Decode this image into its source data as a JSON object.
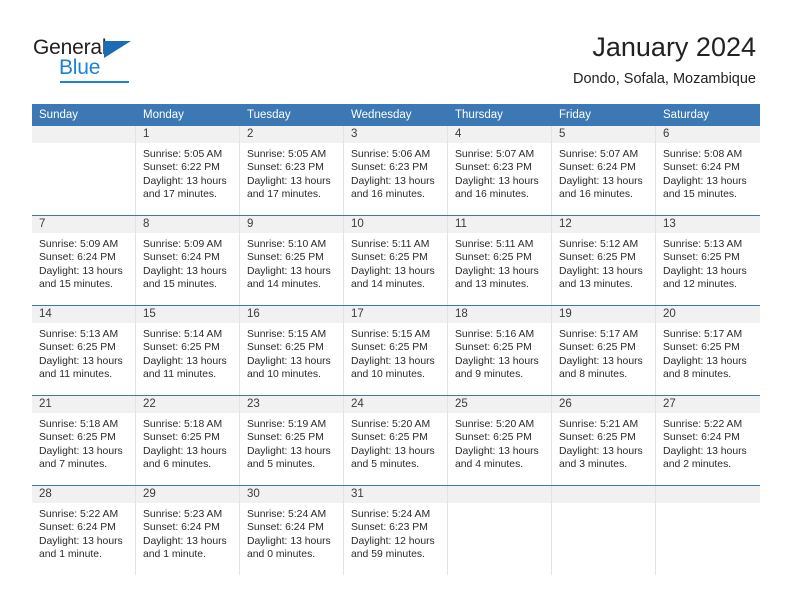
{
  "brand": {
    "name_top": "General",
    "name_bottom": "Blue",
    "logo_icon": "triangle-icon",
    "accent_color": "#1c83d4",
    "triangle_color": "#1c6cb5"
  },
  "header": {
    "title": "January 2024",
    "subtitle": "Dondo, Sofala, Mozambique"
  },
  "calendar": {
    "header_bg": "#3c78b4",
    "daynum_bg": "#f1f1f1",
    "weekday_headers": [
      "Sunday",
      "Monday",
      "Tuesday",
      "Wednesday",
      "Thursday",
      "Friday",
      "Saturday"
    ],
    "weeks": [
      [
        {
          "day": "",
          "sunrise": "",
          "sunset": "",
          "daylight_line1": "",
          "daylight_line2": ""
        },
        {
          "day": "1",
          "sunrise": "Sunrise: 5:05 AM",
          "sunset": "Sunset: 6:22 PM",
          "daylight_line1": "Daylight: 13 hours",
          "daylight_line2": "and 17 minutes."
        },
        {
          "day": "2",
          "sunrise": "Sunrise: 5:05 AM",
          "sunset": "Sunset: 6:23 PM",
          "daylight_line1": "Daylight: 13 hours",
          "daylight_line2": "and 17 minutes."
        },
        {
          "day": "3",
          "sunrise": "Sunrise: 5:06 AM",
          "sunset": "Sunset: 6:23 PM",
          "daylight_line1": "Daylight: 13 hours",
          "daylight_line2": "and 16 minutes."
        },
        {
          "day": "4",
          "sunrise": "Sunrise: 5:07 AM",
          "sunset": "Sunset: 6:23 PM",
          "daylight_line1": "Daylight: 13 hours",
          "daylight_line2": "and 16 minutes."
        },
        {
          "day": "5",
          "sunrise": "Sunrise: 5:07 AM",
          "sunset": "Sunset: 6:24 PM",
          "daylight_line1": "Daylight: 13 hours",
          "daylight_line2": "and 16 minutes."
        },
        {
          "day": "6",
          "sunrise": "Sunrise: 5:08 AM",
          "sunset": "Sunset: 6:24 PM",
          "daylight_line1": "Daylight: 13 hours",
          "daylight_line2": "and 15 minutes."
        }
      ],
      [
        {
          "day": "7",
          "sunrise": "Sunrise: 5:09 AM",
          "sunset": "Sunset: 6:24 PM",
          "daylight_line1": "Daylight: 13 hours",
          "daylight_line2": "and 15 minutes."
        },
        {
          "day": "8",
          "sunrise": "Sunrise: 5:09 AM",
          "sunset": "Sunset: 6:24 PM",
          "daylight_line1": "Daylight: 13 hours",
          "daylight_line2": "and 15 minutes."
        },
        {
          "day": "9",
          "sunrise": "Sunrise: 5:10 AM",
          "sunset": "Sunset: 6:25 PM",
          "daylight_line1": "Daylight: 13 hours",
          "daylight_line2": "and 14 minutes."
        },
        {
          "day": "10",
          "sunrise": "Sunrise: 5:11 AM",
          "sunset": "Sunset: 6:25 PM",
          "daylight_line1": "Daylight: 13 hours",
          "daylight_line2": "and 14 minutes."
        },
        {
          "day": "11",
          "sunrise": "Sunrise: 5:11 AM",
          "sunset": "Sunset: 6:25 PM",
          "daylight_line1": "Daylight: 13 hours",
          "daylight_line2": "and 13 minutes."
        },
        {
          "day": "12",
          "sunrise": "Sunrise: 5:12 AM",
          "sunset": "Sunset: 6:25 PM",
          "daylight_line1": "Daylight: 13 hours",
          "daylight_line2": "and 13 minutes."
        },
        {
          "day": "13",
          "sunrise": "Sunrise: 5:13 AM",
          "sunset": "Sunset: 6:25 PM",
          "daylight_line1": "Daylight: 13 hours",
          "daylight_line2": "and 12 minutes."
        }
      ],
      [
        {
          "day": "14",
          "sunrise": "Sunrise: 5:13 AM",
          "sunset": "Sunset: 6:25 PM",
          "daylight_line1": "Daylight: 13 hours",
          "daylight_line2": "and 11 minutes."
        },
        {
          "day": "15",
          "sunrise": "Sunrise: 5:14 AM",
          "sunset": "Sunset: 6:25 PM",
          "daylight_line1": "Daylight: 13 hours",
          "daylight_line2": "and 11 minutes."
        },
        {
          "day": "16",
          "sunrise": "Sunrise: 5:15 AM",
          "sunset": "Sunset: 6:25 PM",
          "daylight_line1": "Daylight: 13 hours",
          "daylight_line2": "and 10 minutes."
        },
        {
          "day": "17",
          "sunrise": "Sunrise: 5:15 AM",
          "sunset": "Sunset: 6:25 PM",
          "daylight_line1": "Daylight: 13 hours",
          "daylight_line2": "and 10 minutes."
        },
        {
          "day": "18",
          "sunrise": "Sunrise: 5:16 AM",
          "sunset": "Sunset: 6:25 PM",
          "daylight_line1": "Daylight: 13 hours",
          "daylight_line2": "and 9 minutes."
        },
        {
          "day": "19",
          "sunrise": "Sunrise: 5:17 AM",
          "sunset": "Sunset: 6:25 PM",
          "daylight_line1": "Daylight: 13 hours",
          "daylight_line2": "and 8 minutes."
        },
        {
          "day": "20",
          "sunrise": "Sunrise: 5:17 AM",
          "sunset": "Sunset: 6:25 PM",
          "daylight_line1": "Daylight: 13 hours",
          "daylight_line2": "and 8 minutes."
        }
      ],
      [
        {
          "day": "21",
          "sunrise": "Sunrise: 5:18 AM",
          "sunset": "Sunset: 6:25 PM",
          "daylight_line1": "Daylight: 13 hours",
          "daylight_line2": "and 7 minutes."
        },
        {
          "day": "22",
          "sunrise": "Sunrise: 5:18 AM",
          "sunset": "Sunset: 6:25 PM",
          "daylight_line1": "Daylight: 13 hours",
          "daylight_line2": "and 6 minutes."
        },
        {
          "day": "23",
          "sunrise": "Sunrise: 5:19 AM",
          "sunset": "Sunset: 6:25 PM",
          "daylight_line1": "Daylight: 13 hours",
          "daylight_line2": "and 5 minutes."
        },
        {
          "day": "24",
          "sunrise": "Sunrise: 5:20 AM",
          "sunset": "Sunset: 6:25 PM",
          "daylight_line1": "Daylight: 13 hours",
          "daylight_line2": "and 5 minutes."
        },
        {
          "day": "25",
          "sunrise": "Sunrise: 5:20 AM",
          "sunset": "Sunset: 6:25 PM",
          "daylight_line1": "Daylight: 13 hours",
          "daylight_line2": "and 4 minutes."
        },
        {
          "day": "26",
          "sunrise": "Sunrise: 5:21 AM",
          "sunset": "Sunset: 6:25 PM",
          "daylight_line1": "Daylight: 13 hours",
          "daylight_line2": "and 3 minutes."
        },
        {
          "day": "27",
          "sunrise": "Sunrise: 5:22 AM",
          "sunset": "Sunset: 6:24 PM",
          "daylight_line1": "Daylight: 13 hours",
          "daylight_line2": "and 2 minutes."
        }
      ],
      [
        {
          "day": "28",
          "sunrise": "Sunrise: 5:22 AM",
          "sunset": "Sunset: 6:24 PM",
          "daylight_line1": "Daylight: 13 hours",
          "daylight_line2": "and 1 minute."
        },
        {
          "day": "29",
          "sunrise": "Sunrise: 5:23 AM",
          "sunset": "Sunset: 6:24 PM",
          "daylight_line1": "Daylight: 13 hours",
          "daylight_line2": "and 1 minute."
        },
        {
          "day": "30",
          "sunrise": "Sunrise: 5:24 AM",
          "sunset": "Sunset: 6:24 PM",
          "daylight_line1": "Daylight: 13 hours",
          "daylight_line2": "and 0 minutes."
        },
        {
          "day": "31",
          "sunrise": "Sunrise: 5:24 AM",
          "sunset": "Sunset: 6:23 PM",
          "daylight_line1": "Daylight: 12 hours",
          "daylight_line2": "and 59 minutes."
        },
        {
          "day": "",
          "sunrise": "",
          "sunset": "",
          "daylight_line1": "",
          "daylight_line2": ""
        },
        {
          "day": "",
          "sunrise": "",
          "sunset": "",
          "daylight_line1": "",
          "daylight_line2": ""
        },
        {
          "day": "",
          "sunrise": "",
          "sunset": "",
          "daylight_line1": "",
          "daylight_line2": ""
        }
      ]
    ]
  }
}
